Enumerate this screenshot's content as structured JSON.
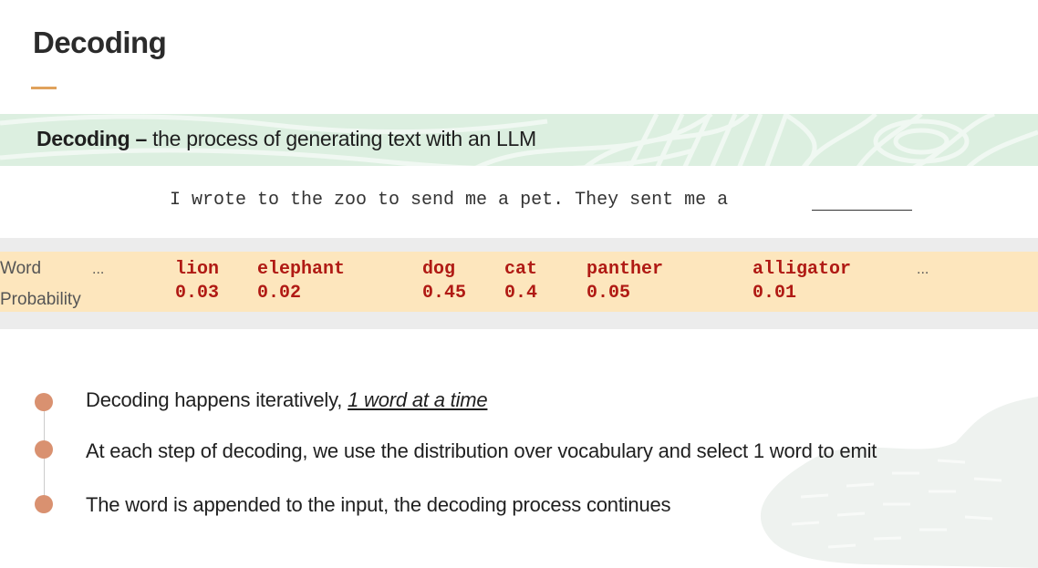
{
  "slide": {
    "title": "Decoding"
  },
  "definition": {
    "term": "Decoding",
    "dash": " – ",
    "text": "the process of generating text with an LLM"
  },
  "example": {
    "sentence": "I wrote to the zoo to send me a pet. They sent me a"
  },
  "table": {
    "row_labels": {
      "word": "Word",
      "probability": "Probability"
    },
    "ellipsis": "...",
    "entries": [
      {
        "word": "lion",
        "probability": "0.03"
      },
      {
        "word": "elephant",
        "probability": "0.02"
      },
      {
        "word": "dog",
        "probability": "0.45"
      },
      {
        "word": "cat",
        "probability": "0.4"
      },
      {
        "word": "panther",
        "probability": "0.05"
      },
      {
        "word": "alligator",
        "probability": "0.01"
      }
    ]
  },
  "bullets": [
    {
      "text": "Decoding happens iteratively, ",
      "emphasis": "1 word at a time"
    },
    {
      "text": "At each step of decoding, we use the distribution over vocabulary and select 1 word to emit"
    },
    {
      "text": "The word is appended to the input, the decoding process continues"
    }
  ],
  "colors": {
    "accent": "#e0a25c",
    "band_green": "#dcefe0",
    "table_band": "#fde6bd",
    "word_red": "#b01a14",
    "dot": "#d99170"
  }
}
